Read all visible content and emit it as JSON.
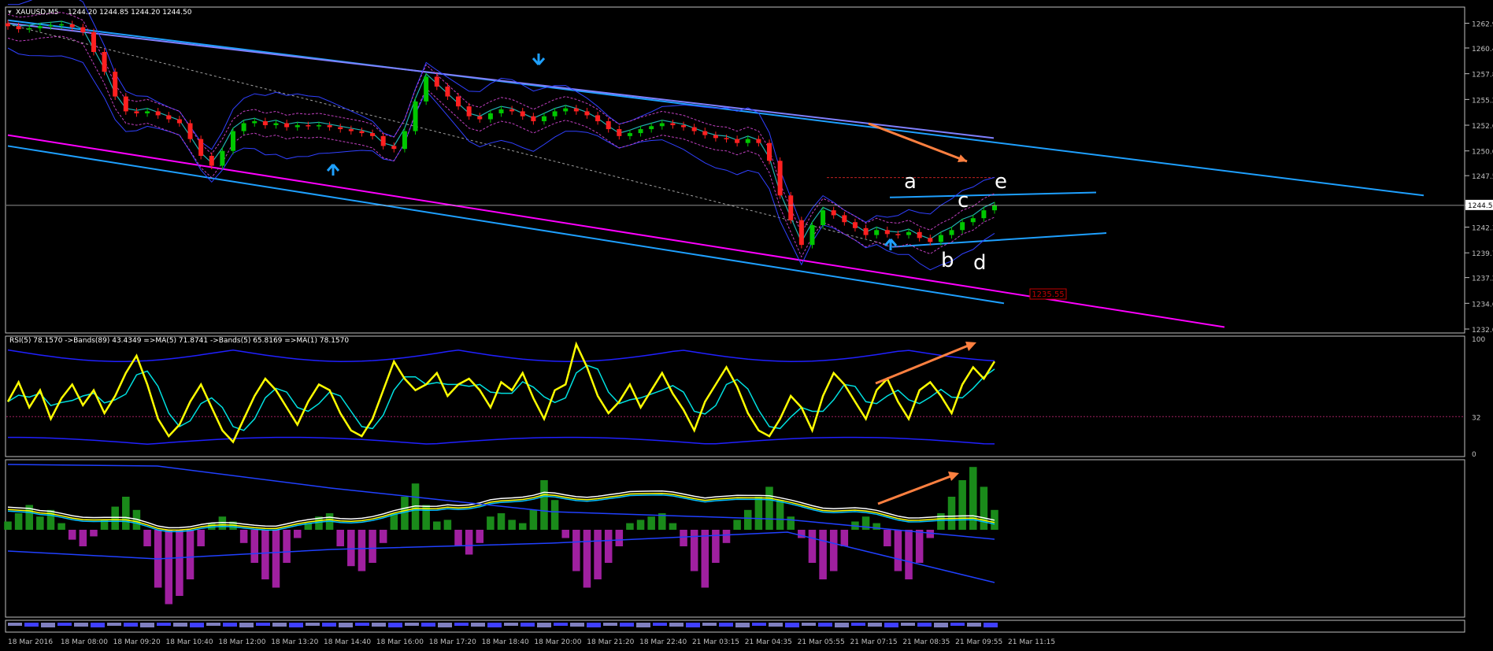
{
  "symbol_header": {
    "symbol": "XAUUSD,M5",
    "ohlc": "1244.20 1244.85 1244.20 1244.50"
  },
  "colors": {
    "background": "#000000",
    "axis": "#c0c0c0",
    "bull_candle": "#00c800",
    "bear_candle": "#ff2020",
    "channel": "#1ea0ff",
    "support_line": "#ff00ff",
    "arrow": "#ff8040",
    "rsi": "#ffff00",
    "rsi_signal": "#00e0e0",
    "bands": "#2020ff",
    "macd_pos": "#1a8a1a",
    "macd_neg": "#a020a0",
    "price_marker": "#c00000"
  },
  "chart_data": [
    {
      "type": "candlestick",
      "panel": "main",
      "ylim": [
        1232.0,
        1263.5
      ],
      "price_ticks": [
        "1262.9",
        "1260.4",
        "1257.8",
        "1255.2",
        "1252.6",
        "1250.0",
        "1247.5",
        "1244.5",
        "1242.3",
        "1239.7",
        "1237.2",
        "1234.6",
        "1232.0"
      ],
      "current_price": "1244.5",
      "target_price_label": "1235.55",
      "wave_labels": [
        "a",
        "b",
        "c",
        "d",
        "e"
      ],
      "close_series_approx": [
        1262.6,
        1262.3,
        1262.4,
        1262.6,
        1262.7,
        1262.8,
        1262.5,
        1262.0,
        1260.0,
        1258.0,
        1255.5,
        1254.0,
        1253.8,
        1254.0,
        1253.6,
        1253.2,
        1252.8,
        1251.2,
        1249.5,
        1248.5,
        1250.0,
        1252.0,
        1252.8,
        1253.0,
        1252.6,
        1252.8,
        1252.4,
        1252.6,
        1252.5,
        1252.6,
        1252.4,
        1252.2,
        1252.0,
        1251.8,
        1251.5,
        1250.5,
        1250.2,
        1252.0,
        1255.0,
        1257.5,
        1256.5,
        1255.5,
        1254.5,
        1253.5,
        1253.2,
        1253.8,
        1254.2,
        1254.0,
        1253.5,
        1253.0,
        1253.5,
        1254.0,
        1254.3,
        1254.0,
        1253.6,
        1253.0,
        1252.2,
        1251.5,
        1251.8,
        1252.2,
        1252.5,
        1252.8,
        1252.6,
        1252.4,
        1252.0,
        1251.6,
        1251.3,
        1251.2,
        1250.8,
        1251.2,
        1250.8,
        1249.0,
        1245.5,
        1243.0,
        1240.5,
        1242.5,
        1244.0,
        1243.5,
        1242.8,
        1242.2,
        1241.5,
        1242.0,
        1241.6,
        1241.5,
        1241.8,
        1241.2,
        1240.8,
        1241.5,
        1242.0,
        1242.8,
        1243.2,
        1244.0,
        1244.5
      ]
    },
    {
      "type": "line",
      "panel": "rsi",
      "title": "RSI(5) 78.1570  ->Bands(89) 43.4349  =>MA(5) 71.8741  ->Bands(5) 65.8169  =>MA(1) 78.1570",
      "ylim": [
        0,
        100
      ],
      "y_ticks": [
        "100",
        "32",
        "0"
      ],
      "level": 32,
      "rsi_values_approx": [
        45,
        62,
        40,
        55,
        30,
        48,
        60,
        42,
        55,
        35,
        50,
        70,
        85,
        60,
        30,
        15,
        25,
        45,
        60,
        40,
        20,
        10,
        30,
        50,
        65,
        55,
        40,
        25,
        45,
        60,
        55,
        35,
        20,
        15,
        30,
        55,
        80,
        65,
        55,
        60,
        70,
        50,
        60,
        65,
        55,
        40,
        62,
        55,
        70,
        48,
        30,
        55,
        60,
        95,
        75,
        50,
        35,
        45,
        60,
        40,
        55,
        70,
        52,
        38,
        20,
        45,
        60,
        75,
        58,
        35,
        20,
        15,
        30,
        50,
        40,
        20,
        50,
        70,
        60,
        45,
        30,
        55,
        65,
        45,
        30,
        55,
        62,
        50,
        35,
        60,
        75,
        65,
        80
      ]
    },
    {
      "type": "bar",
      "panel": "macd",
      "histogram_approx": [
        5,
        10,
        15,
        8,
        12,
        4,
        -6,
        -10,
        -4,
        6,
        14,
        20,
        12,
        -10,
        -35,
        -45,
        -40,
        -30,
        -10,
        4,
        8,
        5,
        -8,
        -20,
        -30,
        -35,
        -20,
        -5,
        4,
        8,
        10,
        -10,
        -22,
        -25,
        -20,
        -8,
        10,
        20,
        28,
        15,
        5,
        6,
        -10,
        -15,
        -8,
        8,
        10,
        6,
        4,
        12,
        30,
        18,
        -5,
        -25,
        -35,
        -30,
        -20,
        -10,
        4,
        6,
        8,
        10,
        4,
        -10,
        -25,
        -35,
        -20,
        -8,
        6,
        12,
        20,
        26,
        18,
        8,
        -5,
        -20,
        -30,
        -25,
        -10,
        5,
        8,
        4,
        -10,
        -25,
        -30,
        -20,
        -5,
        10,
        20,
        30,
        38,
        26,
        12
      ]
    }
  ],
  "time_axis": [
    "18 Mar 2016",
    "18 Mar 08:00",
    "18 Mar 09:20",
    "18 Mar 10:40",
    "18 Mar 12:00",
    "18 Mar 13:20",
    "18 Mar 14:40",
    "18 Mar 16:00",
    "18 Mar 17:20",
    "18 Mar 18:40",
    "18 Mar 20:00",
    "18 Mar 21:20",
    "18 Mar 22:40",
    "21 Mar 03:15",
    "21 Mar 04:35",
    "21 Mar 05:55",
    "21 Mar 07:15",
    "21 Mar 08:35",
    "21 Mar 09:55",
    "21 Mar 11:15"
  ]
}
